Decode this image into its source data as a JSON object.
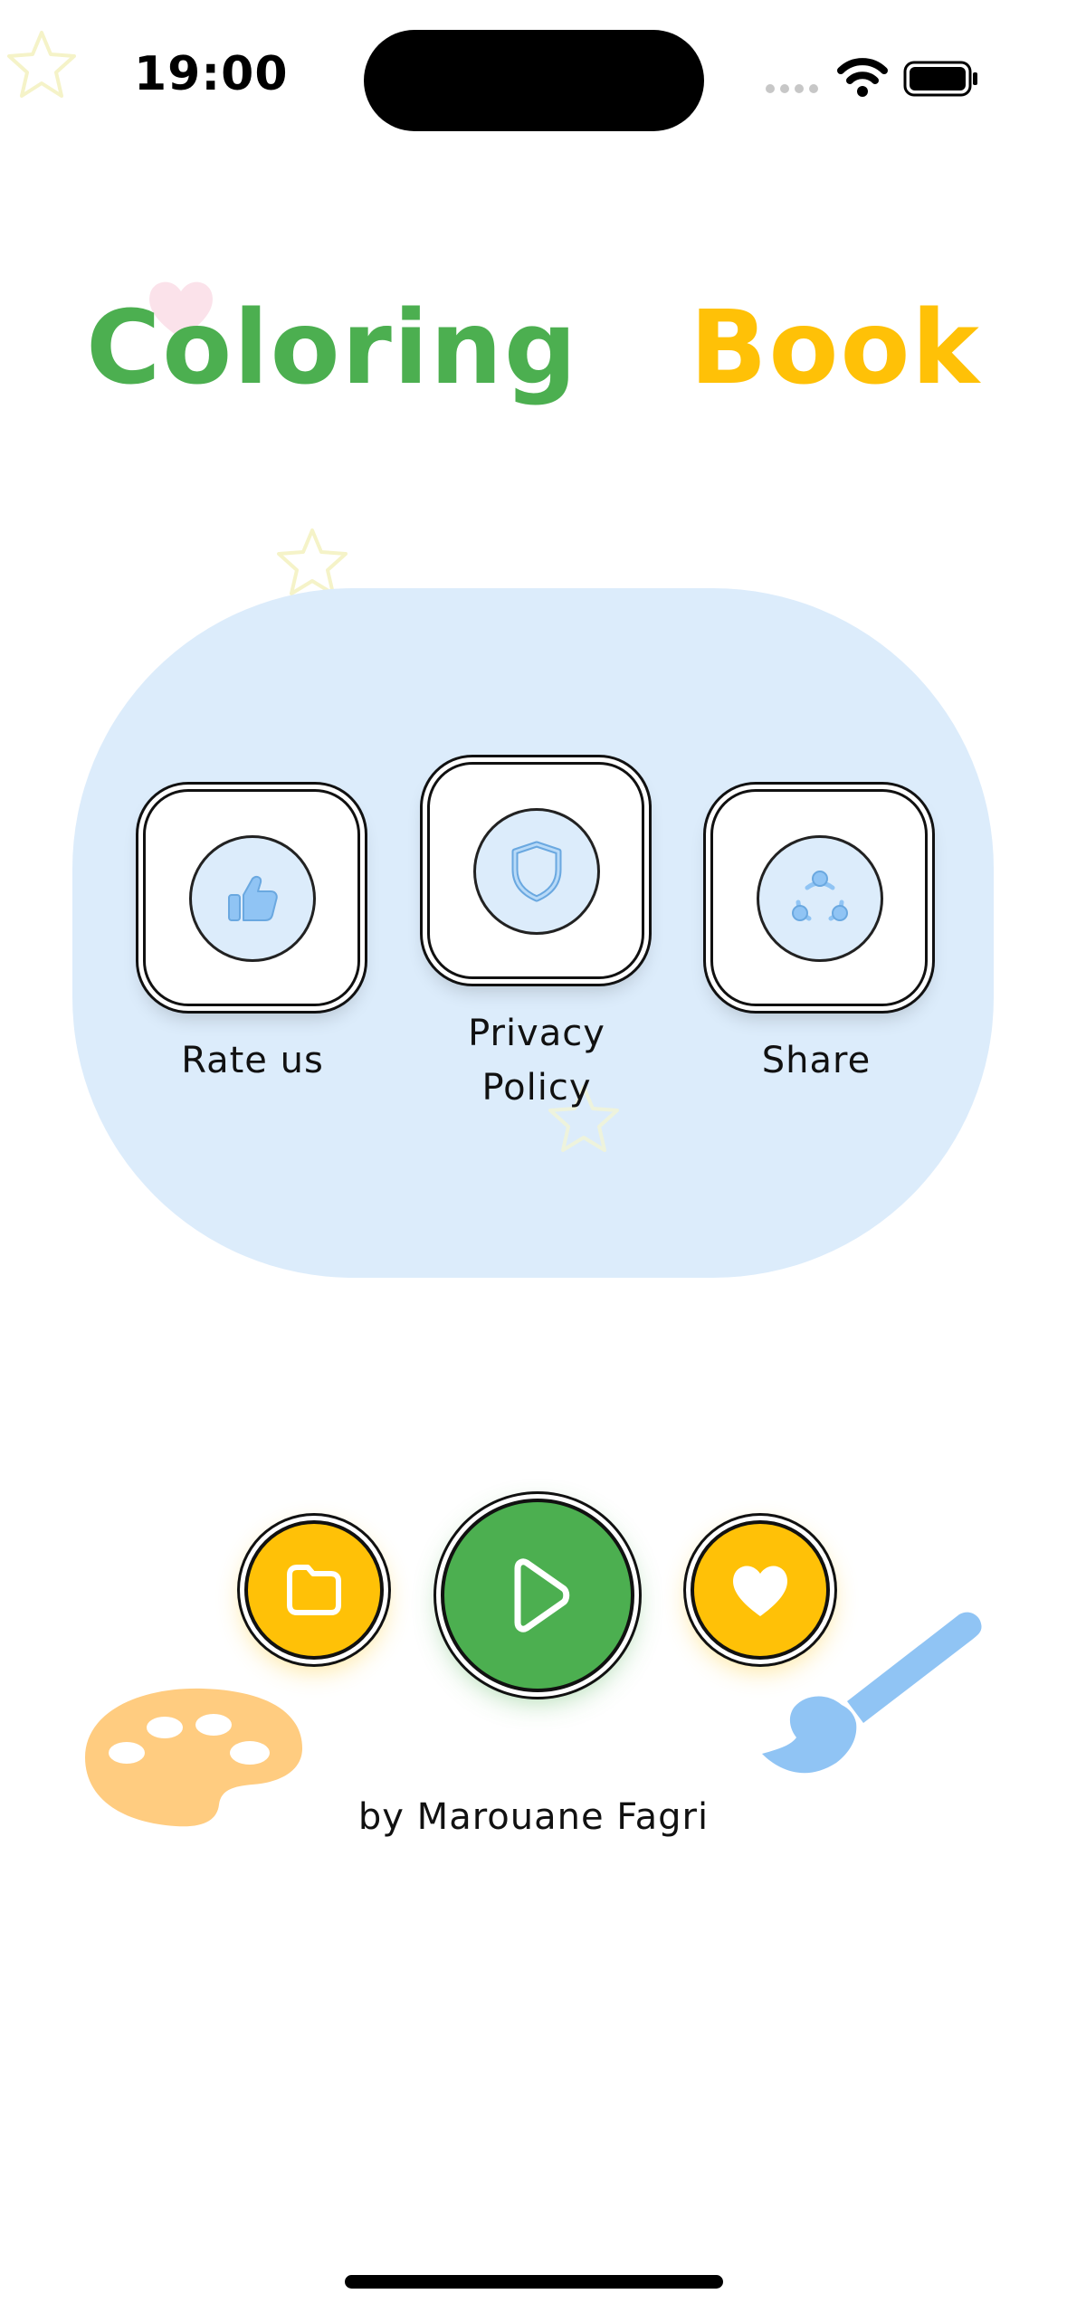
{
  "status_bar": {
    "time": "19:00"
  },
  "title": {
    "part1": "Coloring",
    "part2": "Book",
    "part1_color": "#4caf50",
    "part2_color": "#ffc107"
  },
  "menu": {
    "items": [
      {
        "label": "Rate us",
        "icon": "thumbs-up-icon"
      },
      {
        "label": "Privacy Policy",
        "label_line1": "Privacy",
        "label_line2": "Policy",
        "icon": "shield-icon"
      },
      {
        "label": "Share",
        "icon": "share-icon"
      }
    ],
    "panel_color": "#dcecfb",
    "icon_color": "#90c4f4"
  },
  "actions": {
    "folder": {
      "icon": "folder-icon",
      "color": "#ffc107"
    },
    "play": {
      "icon": "play-icon",
      "color": "#4caf50"
    },
    "favorite": {
      "icon": "heart-icon",
      "color": "#ffc107"
    }
  },
  "decorations": {
    "palette": {
      "icon": "palette-icon",
      "color": "#ffcc80"
    },
    "brush": {
      "icon": "paint-brush-icon",
      "color": "#90c4f4"
    }
  },
  "footer": {
    "author": "by Marouane Fagri"
  }
}
